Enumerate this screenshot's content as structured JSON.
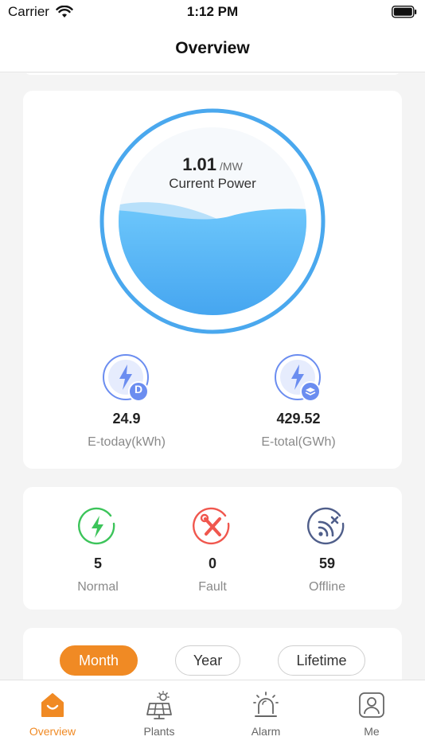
{
  "status_bar": {
    "carrier": "Carrier",
    "time": "1:12 PM"
  },
  "nav": {
    "title": "Overview"
  },
  "power": {
    "value": "1.01",
    "unit": "/MW",
    "caption": "Current Power"
  },
  "energy": {
    "today": {
      "value": "24.9",
      "label": "E-today(kWh)",
      "badge": "D"
    },
    "total": {
      "value": "429.52",
      "label": "E-total(GWh)"
    }
  },
  "status": {
    "normal": {
      "value": "5",
      "label": "Normal"
    },
    "fault": {
      "value": "0",
      "label": "Fault"
    },
    "offline": {
      "value": "59",
      "label": "Offline"
    }
  },
  "period_tabs": [
    {
      "label": "Month",
      "active": true
    },
    {
      "label": "Year",
      "active": false
    },
    {
      "label": "Lifetime",
      "active": false
    }
  ],
  "tab_bar": [
    {
      "label": "Overview",
      "icon": "home-icon",
      "active": true
    },
    {
      "label": "Plants",
      "icon": "solar-panel-icon",
      "active": false
    },
    {
      "label": "Alarm",
      "icon": "alarm-siren-icon",
      "active": false
    },
    {
      "label": "Me",
      "icon": "user-icon",
      "active": false
    }
  ],
  "colors": {
    "accent": "#f08a24",
    "water": "#5ab4f2",
    "ring": "#4aa8ee",
    "normal": "#3cc45a",
    "fault": "#f0574e",
    "offline": "#4f5e8a",
    "energy_icon": "#6b8df0"
  }
}
